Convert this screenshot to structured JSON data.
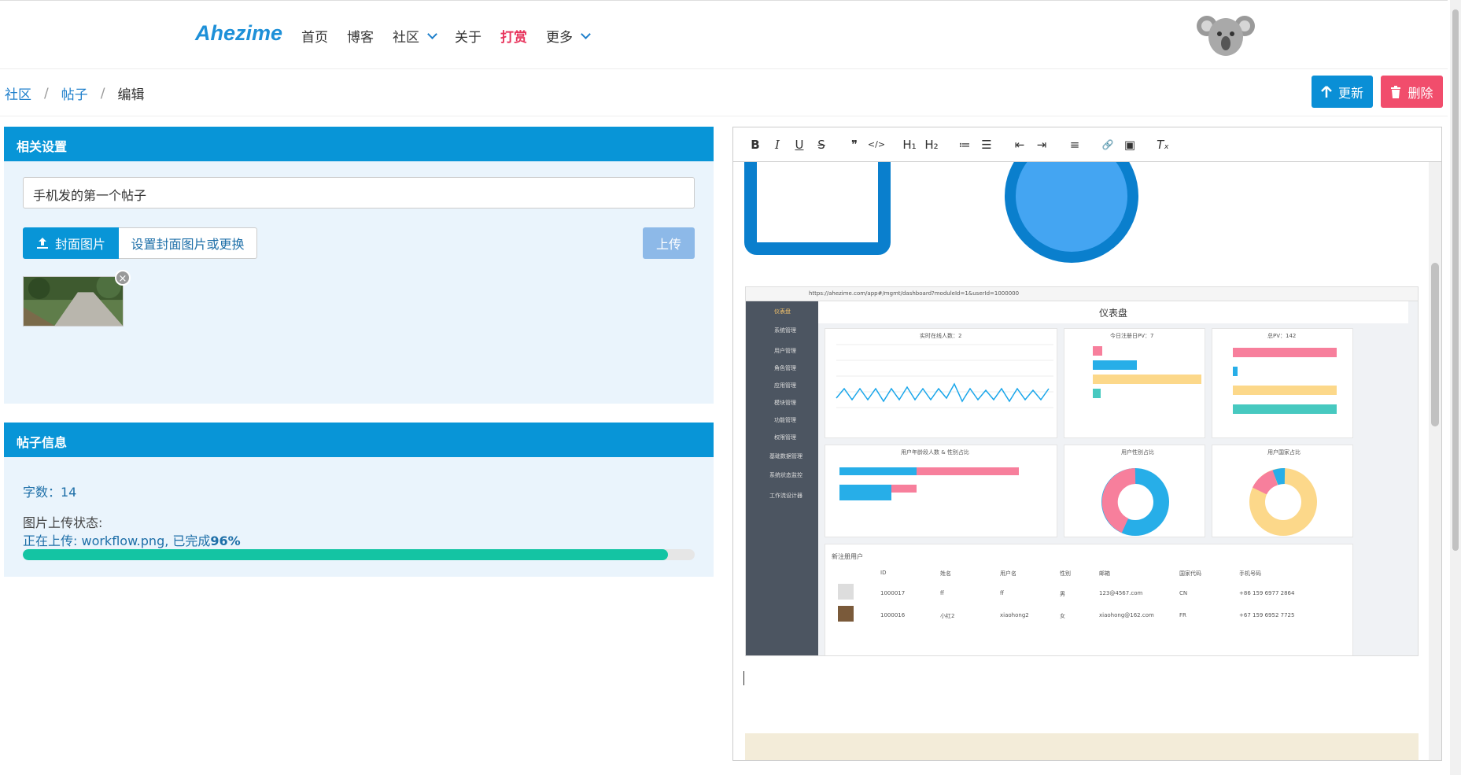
{
  "nav": {
    "brand": "Ahezime",
    "items": [
      "首页",
      "博客",
      "社区",
      "关于",
      "打赏",
      "更多"
    ]
  },
  "breadcrumb": {
    "items": [
      "社区",
      "帖子"
    ],
    "current": "编辑"
  },
  "actions": {
    "update": "更新",
    "delete": "删除"
  },
  "settings": {
    "header": "相关设置",
    "title_value": "手机发的第一个帖子",
    "cover_button": "封面图片",
    "cover_hint": "设置封面图片或更换",
    "upload_button": "上传",
    "close": "×"
  },
  "post_info": {
    "header": "帖子信息",
    "word_count": "字数：14",
    "upload_status_label": "图片上传状态:",
    "upload_status_prefix": "正在上传: workflow.png, 已完成",
    "upload_percent_text": "96%",
    "upload_progress": 0.96
  },
  "toolbar": {
    "bold": "B",
    "italic": "I",
    "underline": "U",
    "strike": "S",
    "quote": "❞",
    "code": "</>",
    "h1": "H₁",
    "h2": "H₂",
    "ol": "≔",
    "ul": "☰",
    "outdent": "⇤",
    "indent": "⇥",
    "align": "≡",
    "link": "🔗",
    "image": "▣",
    "clear": "Tₓ"
  },
  "embedded": {
    "title": "仪表盘",
    "url": "https://ahezime.com/app#/mgmt/dashboard?moduleId=1&userId=1000000",
    "sidebar": [
      "仪表盘",
      "系统管理",
      "用户管理",
      "角色管理",
      "应用管理",
      "模块管理",
      "功能管理",
      "权限管理",
      "基础数据管理",
      "系统状态监控",
      "工作流设计器"
    ],
    "cards": [
      "实时在线人数：2",
      "今日注册日PV：7",
      "总PV：142",
      "用户年龄段人数 & 性别占比",
      "用户性别占比",
      "用户国家占比"
    ],
    "table_title": "新注册用户",
    "table_headers": [
      "ID",
      "姓名",
      "用户名",
      "性别",
      "邮箱",
      "国家代码",
      "手机号码"
    ],
    "rows": [
      [
        "1000017",
        "ff",
        "ff",
        "男",
        "123@4567.com",
        "CN",
        "+86 159 6977 2864"
      ],
      [
        "1000016",
        "小红2",
        "xiaohong2",
        "女",
        "xiaohong@162.com",
        "FR",
        "+67 159 6952 7725"
      ]
    ]
  }
}
